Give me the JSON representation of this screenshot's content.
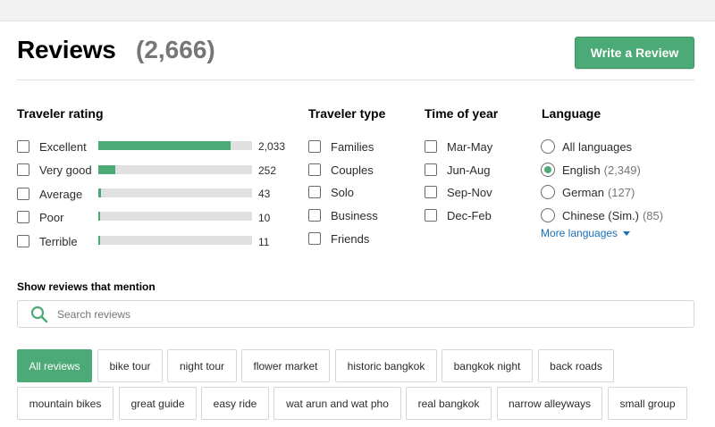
{
  "header": {
    "title": "Reviews",
    "count": "(2,666)",
    "write_button": "Write a Review"
  },
  "colors": {
    "accent": "#4caa76",
    "link": "#1a6fb5",
    "muted": "#767676"
  },
  "traveler_rating": {
    "heading": "Traveler rating",
    "items": [
      {
        "label": "Excellent",
        "count": "2,033",
        "fraction": 0.86
      },
      {
        "label": "Very good",
        "count": "252",
        "fraction": 0.11
      },
      {
        "label": "Average",
        "count": "43",
        "fraction": 0.02
      },
      {
        "label": "Poor",
        "count": "10",
        "fraction": 0.005
      },
      {
        "label": "Terrible",
        "count": "11",
        "fraction": 0.005
      }
    ]
  },
  "traveler_type": {
    "heading": "Traveler type",
    "items": [
      "Families",
      "Couples",
      "Solo",
      "Business",
      "Friends"
    ]
  },
  "time_of_year": {
    "heading": "Time of year",
    "items": [
      "Mar-May",
      "Jun-Aug",
      "Sep-Nov",
      "Dec-Feb"
    ]
  },
  "language": {
    "heading": "Language",
    "items": [
      {
        "label": "All languages",
        "count": "",
        "selected": false
      },
      {
        "label": "English",
        "count": "(2,349)",
        "selected": true
      },
      {
        "label": "German",
        "count": "(127)",
        "selected": false
      },
      {
        "label": "Chinese (Sim.)",
        "count": "(85)",
        "selected": false
      }
    ],
    "more": "More languages"
  },
  "mention": {
    "label": "Show reviews that mention",
    "search_placeholder": "Search reviews",
    "search_value": "",
    "chips": [
      "All reviews",
      "bike tour",
      "night tour",
      "flower market",
      "historic bangkok",
      "bangkok night",
      "back roads",
      "mountain bikes",
      "great guide",
      "easy ride",
      "wat arun and wat pho",
      "real bangkok",
      "narrow alleyways",
      "small group"
    ],
    "active_chip": 0
  }
}
